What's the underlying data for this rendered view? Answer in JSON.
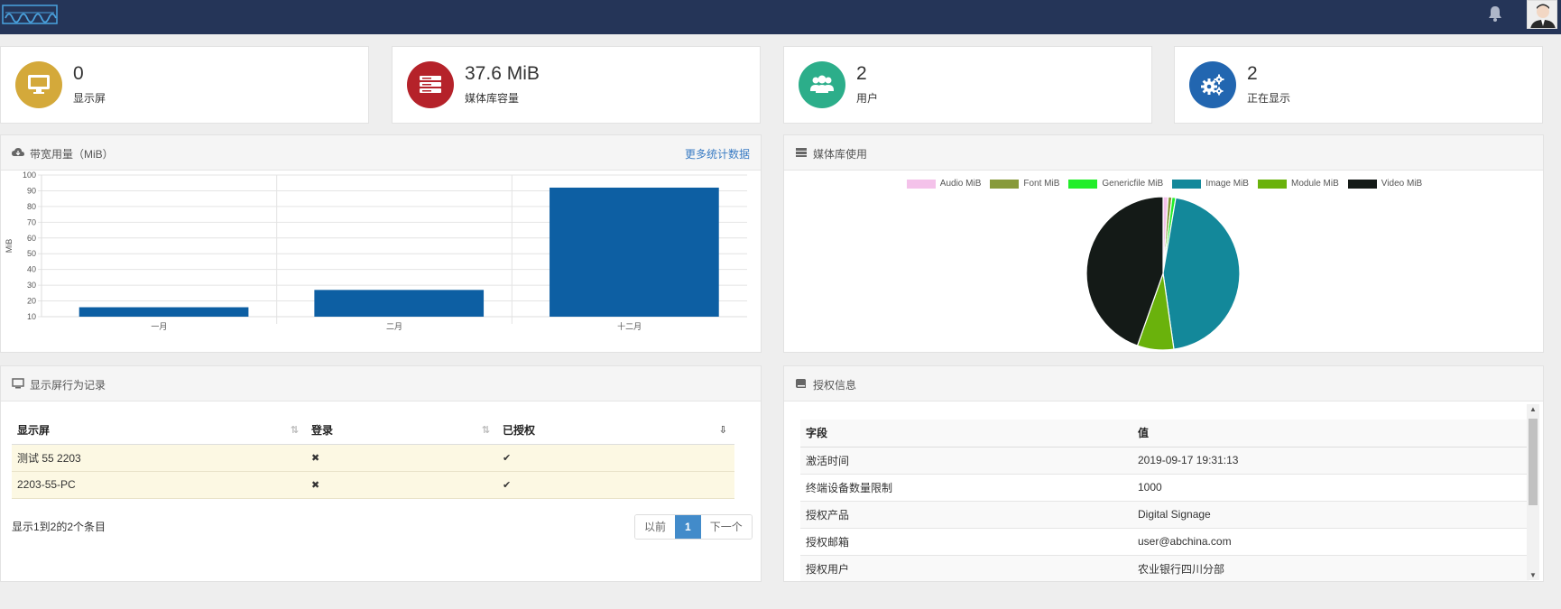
{
  "stats": [
    {
      "value": "0",
      "label": "显示屏",
      "color": "#d4a93a",
      "icon": "monitor-icon"
    },
    {
      "value": "37.6 MiB",
      "label": "媒体库容量",
      "color": "#b5222a",
      "icon": "server-icon"
    },
    {
      "value": "2",
      "label": "用户",
      "color": "#2cae8a",
      "icon": "users-icon"
    },
    {
      "value": "2",
      "label": "正在显示",
      "color": "#2266b0",
      "icon": "gears-icon"
    }
  ],
  "bandwidth": {
    "title": "带宽用量（MiB）",
    "more_link": "更多统计数据"
  },
  "media_usage": {
    "title": "媒体库使用"
  },
  "display_log": {
    "title": "显示屏行为记录",
    "headers": [
      "显示屏",
      "登录",
      "已授权"
    ],
    "rows": [
      {
        "name": "测试 55 2203",
        "logged_in": "✖",
        "authorized": "✔"
      },
      {
        "name": "2203-55-PC",
        "logged_in": "✖",
        "authorized": "✔"
      }
    ],
    "summary": "显示1到2的2个条目",
    "pager": {
      "prev": "以前",
      "current": "1",
      "next": "下一个"
    }
  },
  "license": {
    "title": "授权信息",
    "headers": [
      "字段",
      "值"
    ],
    "rows": [
      {
        "field": "激活时间",
        "value": "2019-09-17 19:31:13"
      },
      {
        "field": "终端设备数量限制",
        "value": "1000"
      },
      {
        "field": "授权产品",
        "value": "Digital Signage"
      },
      {
        "field": "授权邮箱",
        "value": "user@abchina.com"
      },
      {
        "field": "授权用户",
        "value": "农业银行四川分部"
      }
    ]
  },
  "chart_data": [
    {
      "type": "bar",
      "categories": [
        "一月",
        "二月",
        "十二月"
      ],
      "values": [
        16,
        27,
        92
      ],
      "title": "",
      "xlabel": "",
      "ylabel": "MiB",
      "ylim": [
        10,
        100
      ],
      "yticks": [
        10,
        20,
        30,
        40,
        50,
        60,
        70,
        80,
        90,
        100
      ],
      "color": "#0d5fa3",
      "grid": true
    },
    {
      "type": "pie",
      "labels": [
        "Audio MiB",
        "Font MiB",
        "Genericfile MiB",
        "Image MiB",
        "Module MiB",
        "Video MiB"
      ],
      "values": [
        0.4,
        0.3,
        0.3,
        17.0,
        2.9,
        16.8
      ],
      "colors": [
        "#f4c2ea",
        "#879a3a",
        "#22ee2a",
        "#13889a",
        "#6ab20c",
        "#141a17"
      ],
      "legend": "top"
    }
  ]
}
